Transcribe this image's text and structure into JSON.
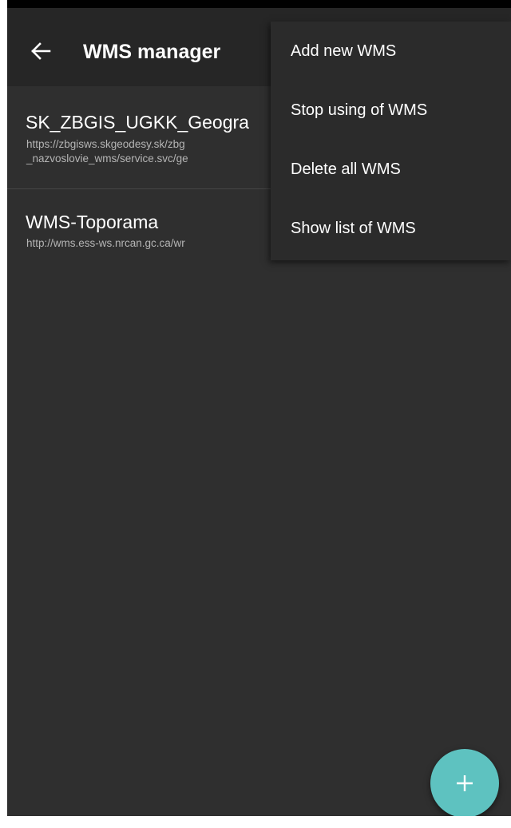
{
  "app_bar": {
    "title": "WMS manager",
    "back_icon": "arrow-back-icon"
  },
  "wms_list": [
    {
      "name": "SK_ZBGIS_UGKK_Geogra",
      "url": "https://zbgisws.skgeodesy.sk/zbg\n_nazvoslovie_wms/service.svc/ge"
    },
    {
      "name": "WMS-Toporama",
      "url": "http://wms.ess-ws.nrcan.gc.ca/wr"
    }
  ],
  "overflow_menu": {
    "items": [
      {
        "label": "Add new WMS"
      },
      {
        "label": "Stop using of WMS"
      },
      {
        "label": "Delete all WMS"
      },
      {
        "label": "Show list of WMS"
      }
    ]
  },
  "fab": {
    "icon": "plus-icon",
    "color": "#5ec2c0"
  },
  "colors": {
    "background": "#2f2f2f",
    "app_bar": "#262626",
    "accent": "#5ec2c0"
  }
}
